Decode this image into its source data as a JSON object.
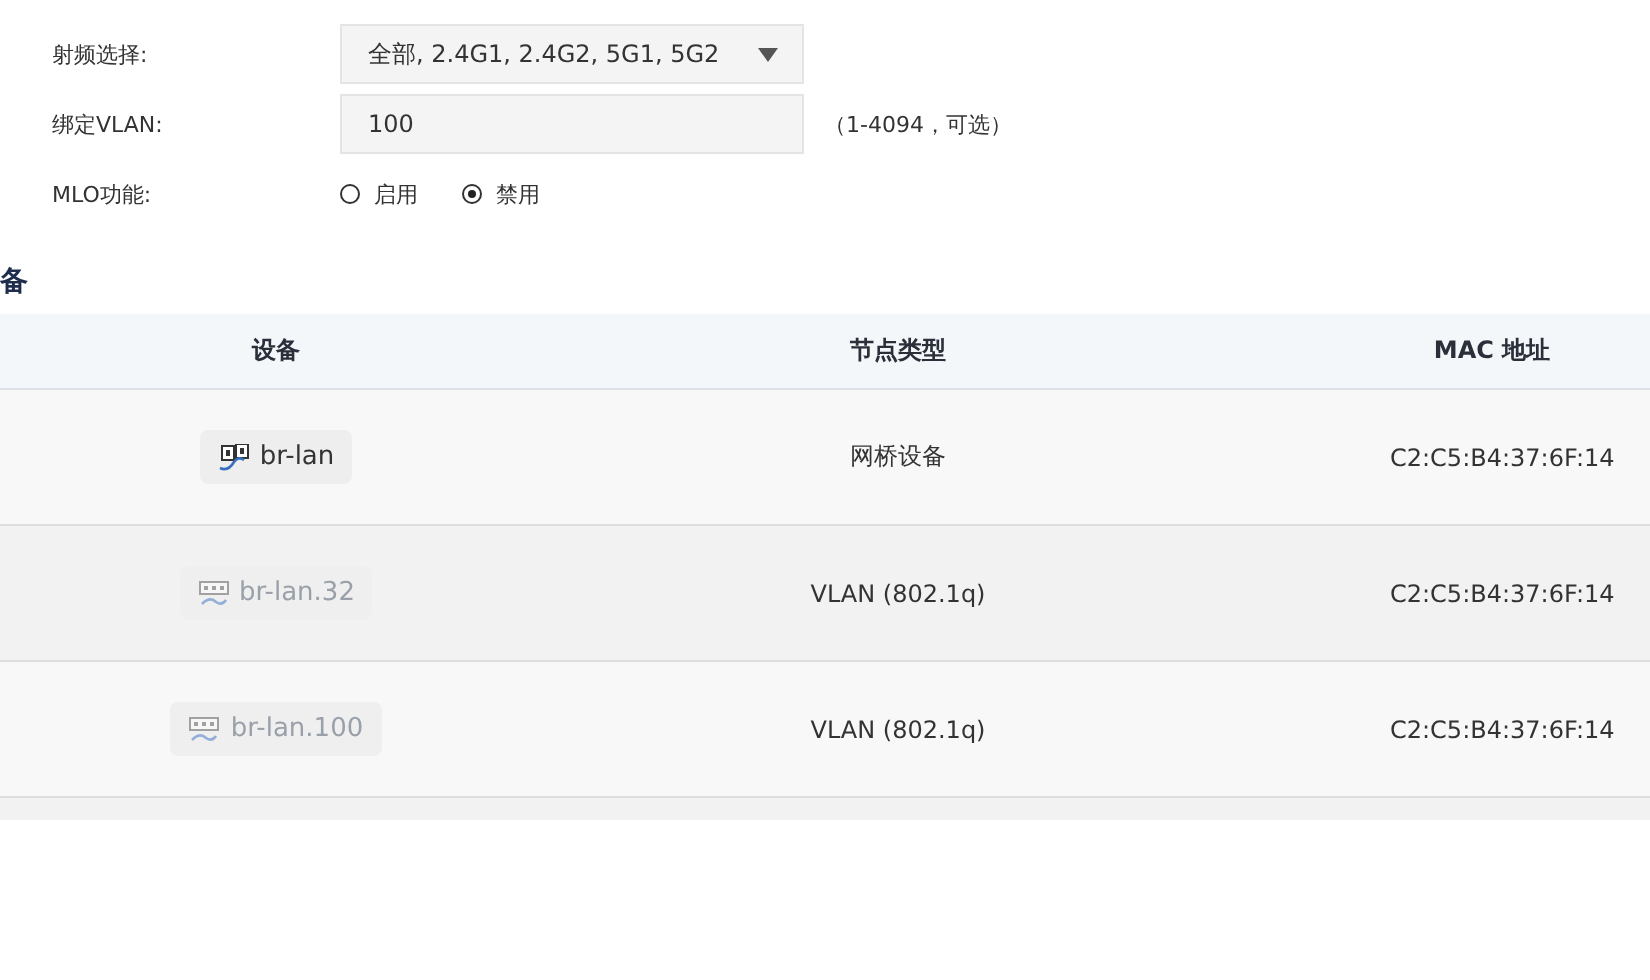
{
  "form": {
    "fields": [
      {
        "kind": "select",
        "label": "射频选择:",
        "value": "全部, 2.4G1, 2.4G2, 5G1, 5G2"
      },
      {
        "kind": "input",
        "label": "绑定VLAN:",
        "value": "100",
        "hint": "（1-4094，可选）"
      },
      {
        "kind": "radio",
        "label": "MLO功能:",
        "options": [
          {
            "label": "启用",
            "selected": false
          },
          {
            "label": "禁用",
            "selected": true
          }
        ]
      }
    ]
  },
  "section_title": "备",
  "table": {
    "columns": [
      "设备",
      "节点类型",
      "MAC 地址"
    ],
    "rows": [
      {
        "device": "br-lan",
        "kind": "bridge",
        "disabled": false,
        "type": "网桥设备",
        "mac": "C2:C5:B4:37:6F:14"
      },
      {
        "device": "br-lan.32",
        "kind": "port",
        "disabled": true,
        "type": "VLAN (802.1q)",
        "mac": "C2:C5:B4:37:6F:14"
      },
      {
        "device": "br-lan.100",
        "kind": "port",
        "disabled": true,
        "type": "VLAN (802.1q)",
        "mac": "C2:C5:B4:37:6F:14"
      }
    ]
  }
}
